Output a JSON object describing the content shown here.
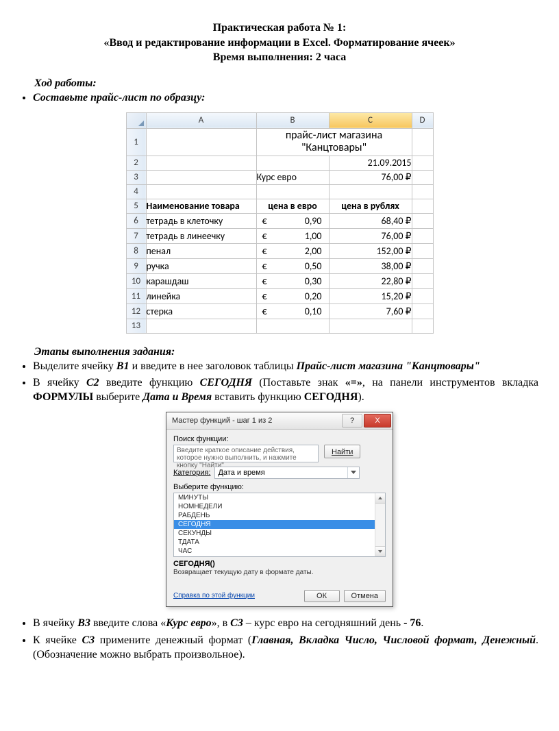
{
  "header": {
    "line1": "Практическая работа № 1:",
    "line2": "«Ввод и редактирование информации в Excel. Форматирование ячеек»",
    "line3": "Время выполнения: 2 часа"
  },
  "section1_title": "Ход работы:",
  "task1": "Составьте прайс-лист по образцу:",
  "excel": {
    "cols": [
      "A",
      "B",
      "C",
      "D"
    ],
    "rows": [
      "1",
      "2",
      "3",
      "4",
      "5",
      "6",
      "7",
      "8",
      "9",
      "10",
      "11",
      "12",
      "13"
    ],
    "title_merged": "прайс-лист магазина \"Канцтовары\"",
    "date": "21.09.2015",
    "rate_label": "Курс евро",
    "rate_value": "76,00 ₽",
    "headers": {
      "name": "Наименование товара",
      "eur": "цена в евро",
      "rub": "цена в рублях"
    },
    "items": [
      {
        "name": "тетрадь в клеточку",
        "eur": "0,90",
        "rub": "68,40 ₽"
      },
      {
        "name": "тетрадь в линеечку",
        "eur": "1,00",
        "rub": "76,00 ₽"
      },
      {
        "name": "пенал",
        "eur": "2,00",
        "rub": "152,00 ₽"
      },
      {
        "name": "ручка",
        "eur": "0,50",
        "rub": "38,00 ₽"
      },
      {
        "name": "карашдаш",
        "eur": "0,30",
        "rub": "22,80 ₽"
      },
      {
        "name": "линейка",
        "eur": "0,20",
        "rub": "15,20 ₽"
      },
      {
        "name": "стерка",
        "eur": "0,10",
        "rub": "7,60 ₽"
      }
    ],
    "euro_sign": "€"
  },
  "section2_title": "Этапы выполнения задания:",
  "step1": {
    "pre": "Выделите ячейку ",
    "b1": "В1",
    "mid": " и введите в нее заголовок таблицы ",
    "bi_tail": "Прайс-лист магазина \"Канцтовары\""
  },
  "step2": {
    "pre": "В ячейку ",
    "c2": "С2",
    "mid1": " введите функцию ",
    "today1": "СЕГОДНЯ",
    "mid2": " (Поставьте знак ",
    "eq": "«=»",
    "mid3": ", на панели инструментов вкладка ",
    "formulas": "ФОРМУЛЫ",
    "mid4": " выберите ",
    "dt": "Дата и Время",
    "mid5": " вставить функцию ",
    "today2": "СЕГОДНЯ",
    "tail": ")."
  },
  "dialog": {
    "title": "Мастер функций - шаг 1 из 2",
    "help_tip": "?",
    "close_tip": "X",
    "search_label": "Поиск функции:",
    "search_placeholder": "Введите краткое описание действия, которое нужно выполнить, и нажмите кнопку \"Найти\"",
    "search_btn": "Найти",
    "category_label": "Категория:",
    "category_value": "Дата и время",
    "select_label": "Выберите функцию:",
    "list": [
      "МИНУТЫ",
      "НОМНЕДЕЛИ",
      "РАБДЕНЬ",
      "СЕГОДНЯ",
      "СЕКУНДЫ",
      "ТДАТА",
      "ЧАС"
    ],
    "selected_index": 3,
    "func_sig": "СЕГОДНЯ()",
    "func_desc": "Возвращает текущую дату в формате даты.",
    "help_link": "Справка по этой функции",
    "ok": "ОК",
    "cancel": "Отмена"
  },
  "step3": {
    "pre": "В ячейку ",
    "b3": "В3",
    "mid1": " введите слова «",
    "kurs": "Курс евро",
    "mid2": "», в ",
    "c3": "С3",
    "mid3": " – курс евро на сегодняшний день ",
    "tail": "- 76",
    "tail_dot": "."
  },
  "step4": {
    "pre": "К ячейке ",
    "c3": "С3",
    "mid1": " примените денежный формат (",
    "chain": "Главная, Вкладка Число, Числовой формат, Денежный",
    "tail": ". (Обозначение можно выбрать произвольное)."
  }
}
